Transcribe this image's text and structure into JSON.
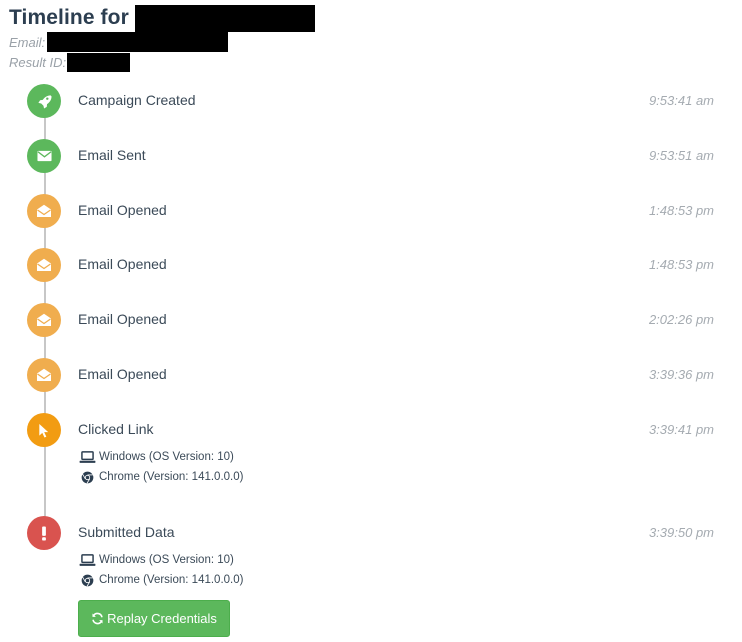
{
  "header": {
    "title": "Timeline for",
    "email_label": "Email:",
    "result_id_label": "Result ID:"
  },
  "events": [
    {
      "label": "Campaign Created",
      "time": "9:53:41 am",
      "icon": "rocket-icon",
      "color": "#5cb85c"
    },
    {
      "label": "Email Sent",
      "time": "9:53:51 am",
      "icon": "envelope-icon",
      "color": "#5cb85c"
    },
    {
      "label": "Email Opened",
      "time": "1:48:53 pm",
      "icon": "envelope-open-icon",
      "color": "#f0ad4e"
    },
    {
      "label": "Email Opened",
      "time": "1:48:53 pm",
      "icon": "envelope-open-icon",
      "color": "#f0ad4e"
    },
    {
      "label": "Email Opened",
      "time": "2:02:26 pm",
      "icon": "envelope-open-icon",
      "color": "#f0ad4e"
    },
    {
      "label": "Email Opened",
      "time": "3:39:36 pm",
      "icon": "envelope-open-icon",
      "color": "#f0ad4e"
    },
    {
      "label": "Clicked Link",
      "time": "3:39:41 pm",
      "icon": "mouse-pointer-icon",
      "color": "#f29c12",
      "details": {
        "os": "Windows (OS Version: 10)",
        "browser": "Chrome (Version: 141.0.0.0)"
      }
    },
    {
      "label": "Submitted Data",
      "time": "3:39:50 pm",
      "icon": "exclamation-icon",
      "color": "#d9534f",
      "details": {
        "os": "Windows (OS Version: 10)",
        "browser": "Chrome (Version: 141.0.0.0)"
      }
    }
  ],
  "replay_button": {
    "label": "Replay Credentials",
    "icon": "refresh-icon"
  }
}
